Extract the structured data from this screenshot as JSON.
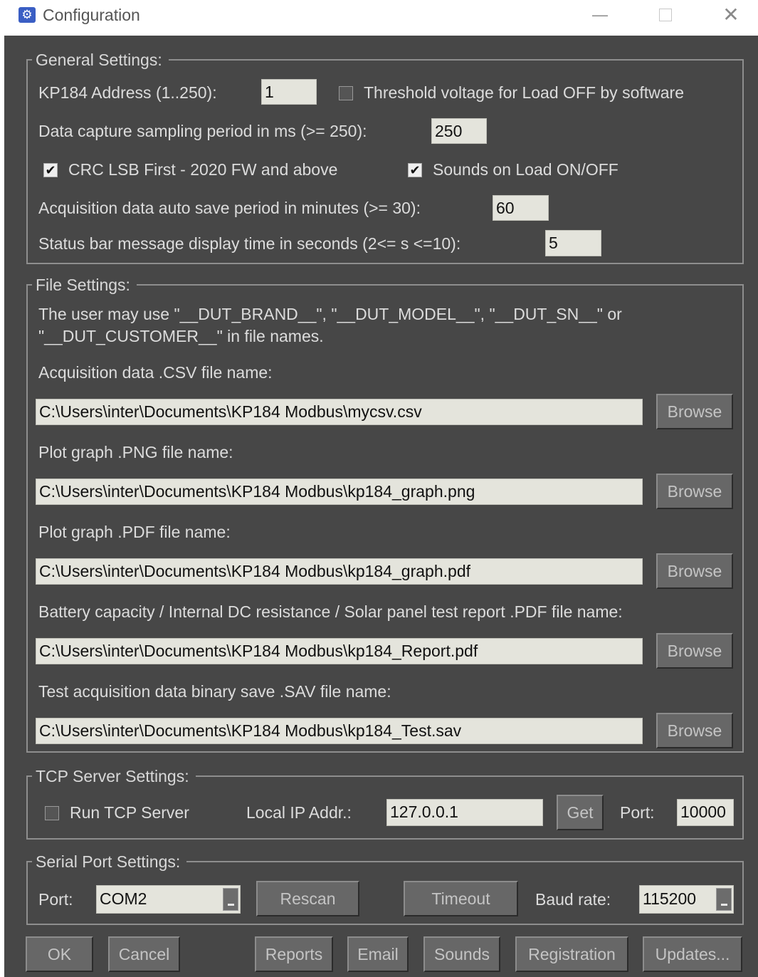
{
  "window": {
    "title": "Configuration",
    "minimize": "—",
    "close": "✕"
  },
  "general": {
    "title": "General Settings:",
    "kp184_address_label": "KP184 Address (1..250):",
    "kp184_address": "1",
    "threshold_label": "Threshold voltage for Load OFF by software",
    "threshold_checked": false,
    "sampling_label": "Data capture sampling period in ms (>= 250):",
    "sampling": "250",
    "crc_label": "CRC LSB First - 2020 FW and above",
    "crc_checked": true,
    "sounds_label": "Sounds on Load ON/OFF",
    "sounds_checked": true,
    "autosave_label": "Acquisition data auto save period in minutes (>= 30):",
    "autosave": "60",
    "status_label": "Status bar message display time in seconds (2<= s <=10):",
    "status": "5"
  },
  "file": {
    "title": "File Settings:",
    "note_line1": "The user may use \"__DUT_BRAND__\", \"__DUT_MODEL__\", \"__DUT_SN__\" or",
    "note_line2": "\"__DUT_CUSTOMER__\" in file names.",
    "browse_label": "Browse",
    "csv_label": "Acquisition data .CSV file name:",
    "csv_path": "C:\\Users\\inter\\Documents\\KP184 Modbus\\mycsv.csv",
    "png_label": "Plot graph .PNG file name:",
    "png_path": "C:\\Users\\inter\\Documents\\KP184 Modbus\\kp184_graph.png",
    "pdf_label": "Plot graph .PDF file name:",
    "pdf_path": "C:\\Users\\inter\\Documents\\KP184 Modbus\\kp184_graph.pdf",
    "report_label": "Battery capacity / Internal DC resistance / Solar panel test report .PDF file name:",
    "report_path": "C:\\Users\\inter\\Documents\\KP184 Modbus\\kp184_Report.pdf",
    "sav_label": "Test acquisition data binary save .SAV file name:",
    "sav_path": "C:\\Users\\inter\\Documents\\KP184 Modbus\\kp184_Test.sav"
  },
  "tcp": {
    "title": "TCP Server Settings:",
    "run_label": "Run TCP Server",
    "run_checked": false,
    "ip_label": "Local IP Addr.:",
    "ip": "127.0.0.1",
    "get_label": "Get",
    "port_label": "Port:",
    "port": "10000"
  },
  "serial": {
    "title": "Serial Port Settings:",
    "port_label": "Port:",
    "port": "COM2",
    "rescan_label": "Rescan",
    "timeout_label": "Timeout",
    "baud_label": "Baud rate:",
    "baud": "115200"
  },
  "buttons": {
    "ok": "OK",
    "cancel": "Cancel",
    "reports": "Reports",
    "email": "Email",
    "sounds": "Sounds",
    "registration": "Registration",
    "updates": "Updates..."
  },
  "icons": {
    "app": "gear-icon",
    "check_mark": "✔",
    "dropdown": "dropdown-arrow-icon"
  },
  "colors": {
    "dialog_bg": "#474747",
    "field_bg": "#e4e4dc",
    "button_bg": "#676767",
    "text": "#dcdcdc"
  }
}
